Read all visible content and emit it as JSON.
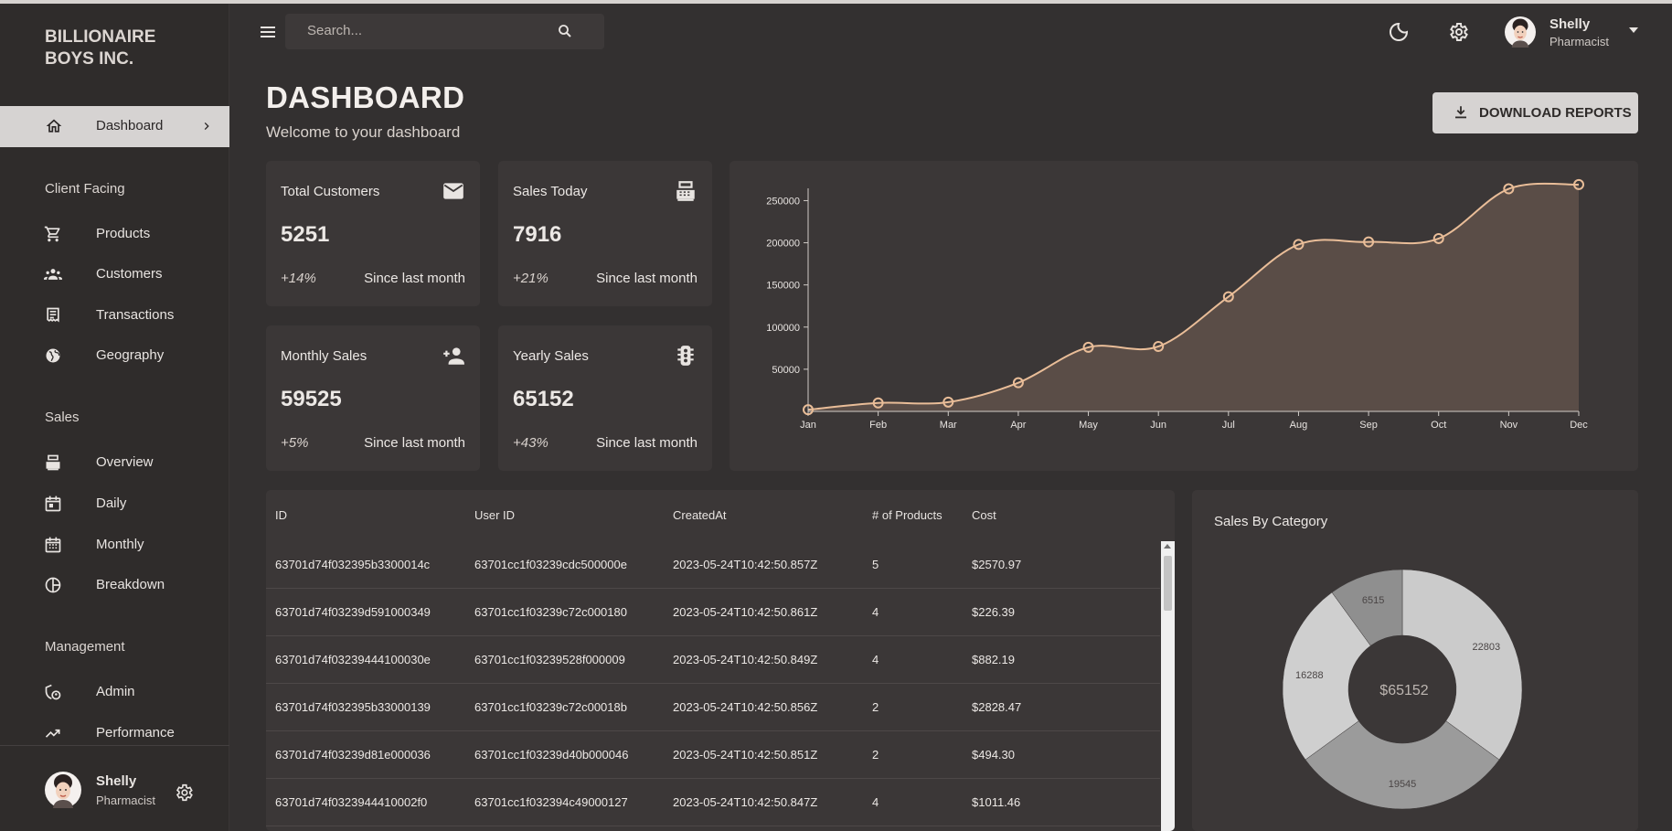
{
  "brand": {
    "line1": "BILLIONAIRE",
    "line2": "BOYS INC."
  },
  "sidebar": {
    "active": {
      "label": "Dashboard"
    },
    "sections": {
      "client": "Client Facing",
      "sales": "Sales",
      "management": "Management"
    },
    "items": {
      "products": "Products",
      "customers": "Customers",
      "transactions": "Transactions",
      "geography": "Geography",
      "overview": "Overview",
      "daily": "Daily",
      "monthly": "Monthly",
      "breakdown": "Breakdown",
      "admin": "Admin",
      "performance": "Performance"
    },
    "footer": {
      "name": "Shelly",
      "role": "Pharmacist"
    }
  },
  "topbar": {
    "search_placeholder": "Search...",
    "user": {
      "name": "Shelly",
      "role": "Pharmacist"
    }
  },
  "header": {
    "title": "DASHBOARD",
    "subtitle": "Welcome to your dashboard",
    "download_label": "DOWNLOAD REPORTS"
  },
  "stats": [
    {
      "title": "Total Customers",
      "value": "5251",
      "pct": "+14%",
      "since": "Since last month",
      "icon": "email-icon"
    },
    {
      "title": "Sales Today",
      "value": "7916",
      "pct": "+21%",
      "since": "Since last month",
      "icon": "point-of-sale-icon"
    },
    {
      "title": "Monthly Sales",
      "value": "59525",
      "pct": "+5%",
      "since": "Since last month",
      "icon": "person-add-icon"
    },
    {
      "title": "Yearly Sales",
      "value": "65152",
      "pct": "+43%",
      "since": "Since last month",
      "icon": "traffic-icon"
    }
  ],
  "table": {
    "headers": [
      "ID",
      "User ID",
      "CreatedAt",
      "# of Products",
      "Cost"
    ],
    "rows": [
      [
        "63701d74f032395b3300014c",
        "63701cc1f03239cdc500000e",
        "2023-05-24T10:42:50.857Z",
        "5",
        "$2570.97"
      ],
      [
        "63701d74f03239d591000349",
        "63701cc1f03239c72c000180",
        "2023-05-24T10:42:50.861Z",
        "4",
        "$226.39"
      ],
      [
        "63701d74f03239444100030e",
        "63701cc1f03239528f000009",
        "2023-05-24T10:42:50.849Z",
        "4",
        "$882.19"
      ],
      [
        "63701d74f032395b33000139",
        "63701cc1f03239c72c00018b",
        "2023-05-24T10:42:50.856Z",
        "2",
        "$2828.47"
      ],
      [
        "63701d74f03239d81e000036",
        "63701cc1f03239d40b000046",
        "2023-05-24T10:42:50.851Z",
        "2",
        "$494.30"
      ],
      [
        "63701d74f0323944410002f0",
        "63701cc1f032394c49000127",
        "2023-05-24T10:42:50.847Z",
        "4",
        "$1011.46"
      ]
    ]
  },
  "pie": {
    "title": "Sales By Category",
    "center_label": "$65152"
  },
  "colors": {
    "accent": "#e9bd98",
    "area_fill": "#5a4d47",
    "button_bg": "#d6d3d2"
  },
  "chart_data": [
    {
      "type": "area",
      "title": "",
      "xlabel": "",
      "ylabel": "",
      "categories": [
        "Jan",
        "Feb",
        "Mar",
        "Apr",
        "May",
        "Jun",
        "Jul",
        "Aug",
        "Sep",
        "Oct",
        "Nov",
        "Dec"
      ],
      "series": [
        {
          "values": [
            2000,
            10000,
            11000,
            34000,
            76000,
            77000,
            136000,
            198000,
            201000,
            205000,
            264000,
            269000
          ]
        }
      ],
      "yticks": [
        50000,
        100000,
        150000,
        200000,
        250000
      ],
      "ylim": [
        0,
        270000
      ],
      "grid": false
    },
    {
      "type": "pie",
      "title": "Sales By Category",
      "labels": [
        "22803",
        "19545",
        "16288",
        "6515"
      ],
      "values": [
        22803,
        19545,
        16288,
        6515
      ],
      "colors": [
        "#cbcbcb",
        "#9b9b9b",
        "#cfcfcf",
        "#8f8f8f"
      ],
      "center_text": "$65152"
    }
  ]
}
